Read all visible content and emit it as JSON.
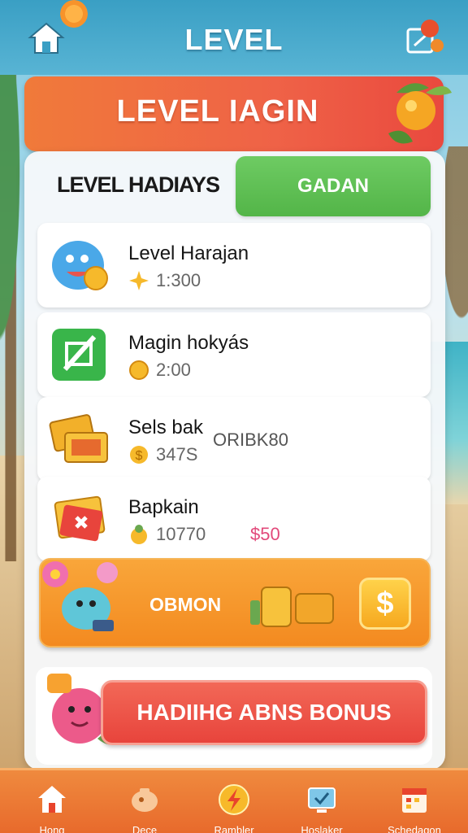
{
  "header": {
    "title": "LEVEL"
  },
  "banner": {
    "title": "LEVEL IAGIN"
  },
  "panel": {
    "heading": "LEVEL HADIAYS",
    "action_label": "GADAN"
  },
  "items": [
    {
      "name": "Level Harajan",
      "value": "1:300",
      "extra": ""
    },
    {
      "name": "Magin hokyás",
      "value": "2:00",
      "extra": ""
    },
    {
      "name": "Sels bak",
      "value": "347S",
      "extra": "ORIBK80"
    },
    {
      "name": "Bapkain",
      "value": "10770",
      "extra": "50"
    }
  ],
  "promo": {
    "label": "OBMON",
    "icon": "dollar-icon"
  },
  "bonus": {
    "label": "HADIIHG ABNS BONUS"
  },
  "nav": [
    {
      "label": "Hong",
      "icon": "home-icon"
    },
    {
      "label": "Dece",
      "icon": "piggy-icon"
    },
    {
      "label": "Rambler",
      "icon": "bolt-icon"
    },
    {
      "label": "Hoslaker",
      "icon": "screen-icon"
    },
    {
      "label": "Schedagon",
      "icon": "calendar-icon"
    }
  ],
  "colors": {
    "header": "#3a9fc4",
    "banner": "#ef6247",
    "action": "#5cbf50",
    "promo": "#f6961f",
    "bonus": "#eb5047",
    "nav": "#eb7a35"
  }
}
